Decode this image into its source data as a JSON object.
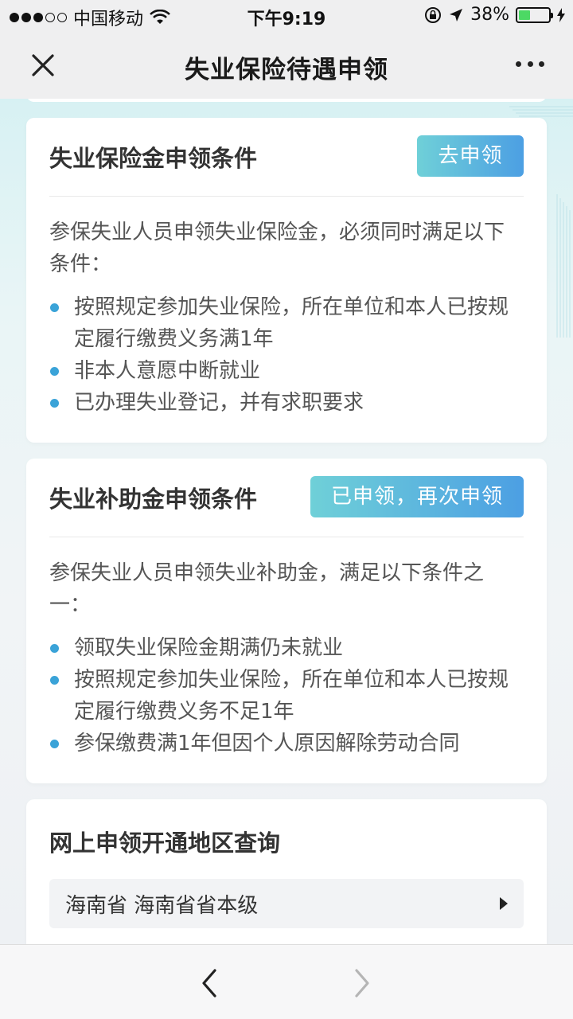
{
  "status_bar": {
    "carrier": "中国移动",
    "time": "下午9:19",
    "battery_percent": "38%",
    "battery_level": 0.38
  },
  "nav": {
    "title": "失业保险待遇申领"
  },
  "card1": {
    "title": "失业保险金申领条件",
    "button": "去申领",
    "intro": "参保失业人员申领失业保险金，必须同时满足以下条件：",
    "items": [
      "按照规定参加失业保险，所在单位和本人已按规定履行缴费义务满1年",
      "非本人意愿中断就业",
      "已办理失业登记，并有求职要求"
    ]
  },
  "card2": {
    "title": "失业补助金申领条件",
    "button": "已申领，再次申领",
    "intro": "参保失业人员申领失业补助金，满足以下条件之一：",
    "items": [
      "领取失业保险金期满仍未就业",
      "按照规定参加失业保险，所在单位和本人已按规定履行缴费义务不足1年",
      "参保缴费满1年但因个人原因解除劳动合同"
    ]
  },
  "card3": {
    "title": "网上申领开通地区查询",
    "region_value": "海南省 海南省省本级"
  },
  "colors": {
    "accent_start": "#6fd0d8",
    "accent_end": "#4c9fe3",
    "bullet": "#3aa3d8"
  }
}
